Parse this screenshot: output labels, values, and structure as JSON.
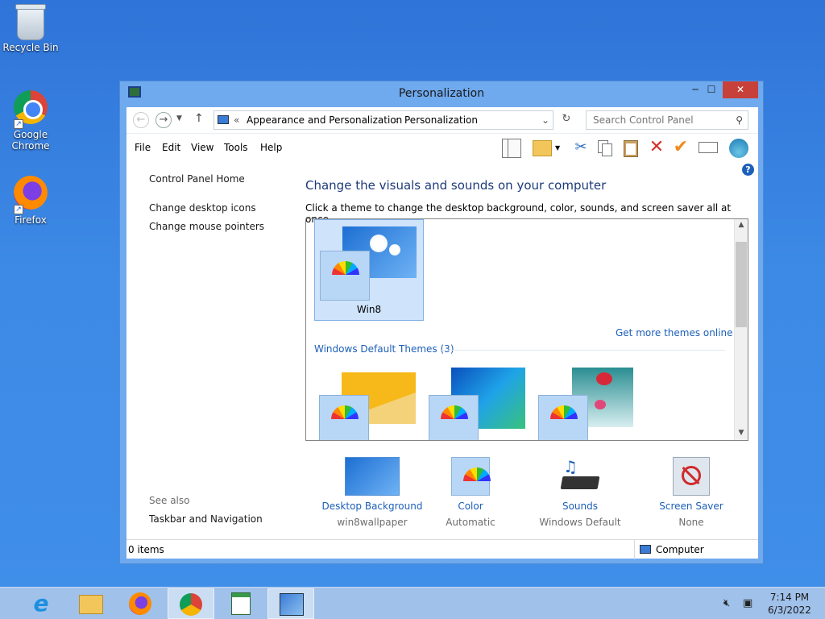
{
  "desktop": {
    "icons": [
      {
        "label": "Recycle Bin",
        "icon": "recycle-bin-icon"
      },
      {
        "label": "Google Chrome",
        "icon": "chrome-icon"
      },
      {
        "label": "Firefox",
        "icon": "firefox-icon"
      }
    ]
  },
  "window": {
    "title": "Personalization",
    "controls": {
      "minimize": "─",
      "maximize": "☐",
      "close": "✕"
    },
    "address": {
      "prefix": "«",
      "crumbs": [
        "Appearance and Personalization",
        "Personalization"
      ],
      "separator": "›"
    },
    "search": {
      "placeholder": "Search Control Panel"
    },
    "menu": [
      "File",
      "Edit",
      "View",
      "Tools",
      "Help"
    ],
    "left_pane": {
      "home": "Control Panel Home",
      "links": [
        "Change desktop icons",
        "Change mouse pointers"
      ],
      "see_also_title": "See also",
      "see_also": [
        "Taskbar and Navigation"
      ]
    },
    "main": {
      "heading": "Change the visuals and sounds on your computer",
      "subtext": "Click a theme to change the desktop background, color, sounds, and screen saver all at once.",
      "selected_theme": "Win8",
      "more_themes_link": "Get more themes online",
      "group_label": "Windows Default Themes (3)",
      "bottom_items": [
        {
          "label": "Desktop Background",
          "value": "win8wallpaper"
        },
        {
          "label": "Color",
          "value": "Automatic"
        },
        {
          "label": "Sounds",
          "value": "Windows Default"
        },
        {
          "label": "Screen Saver",
          "value": "None"
        }
      ]
    },
    "status": {
      "items": "0 items",
      "location": "Computer"
    }
  },
  "taskbar": {
    "time": "7:14 PM",
    "date": "6/3/2022"
  },
  "colors": {
    "desktop": "#3d8ae6",
    "window_frame": "#6fa9ee",
    "link": "#1c5fb8",
    "close": "#c7413a",
    "taskbar": "#9fc1ea"
  }
}
